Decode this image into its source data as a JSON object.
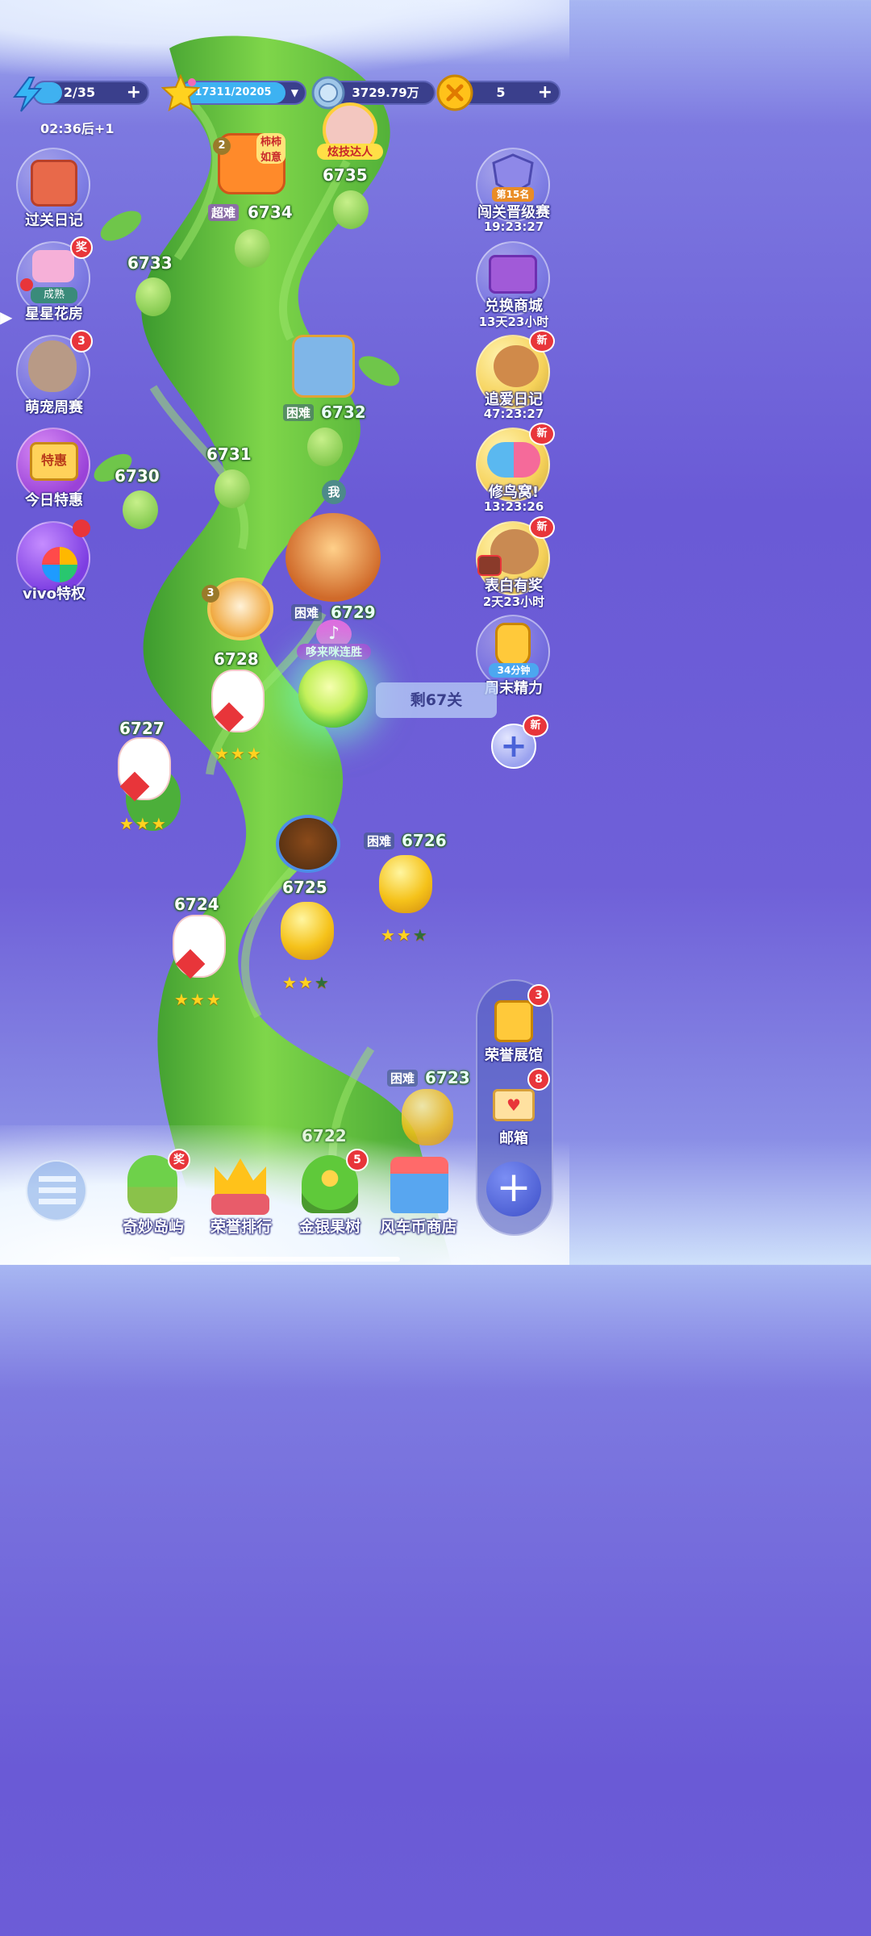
{
  "topbar": {
    "energy": {
      "value": "2/35",
      "plus": "+"
    },
    "stars": {
      "value": "17311/20205"
    },
    "coins": {
      "value": "3729.79万"
    },
    "tokens": {
      "value": "5",
      "plus": "+"
    },
    "timer": "02:36后+1"
  },
  "left_menu": [
    {
      "label": "过关日记"
    },
    {
      "label": "星星花房",
      "badge": "奖",
      "sub": "成熟"
    },
    {
      "label": "萌宠周赛",
      "badge": "3"
    },
    {
      "label": "今日特惠",
      "sub": "特惠"
    },
    {
      "label": "vivo特权"
    }
  ],
  "right_menu": [
    {
      "label": "闯关晋级赛",
      "timer": "19:23:27",
      "sub": "第15名"
    },
    {
      "label": "兑换商城",
      "timer": "13天23小时"
    },
    {
      "label": "追爱日记",
      "timer": "47:23:27",
      "badge": "新"
    },
    {
      "label": "修鸟窝!",
      "timer": "13:23:26",
      "badge": "新"
    },
    {
      "label": "表白有奖",
      "timer": "2天23小时",
      "badge": "新"
    },
    {
      "label": "周末精力",
      "sub": "34分钟"
    }
  ],
  "add_button_badge": "新",
  "levels": {
    "l6722": "6722",
    "l6723": "6723",
    "l6724": "6724",
    "l6725": "6725",
    "l6726": "6726",
    "l6727": "6727",
    "l6728": "6728",
    "l6729": "6729",
    "l6730": "6730",
    "l6731": "6731",
    "l6732": "6732",
    "l6733": "6733",
    "l6734": "6734",
    "l6735": "6735"
  },
  "tags": {
    "hard": "困难",
    "super_hard": "超难"
  },
  "banners": {
    "friend_top": "炫技达人",
    "sign_top": "柿柿如意",
    "me": "我",
    "streak": "哆来咪连胜",
    "remaining": "剩67关",
    "sign_num": "2",
    "sign_num2": "3"
  },
  "bottom_nav": [
    {
      "label": "奇妙岛屿",
      "badge": "奖"
    },
    {
      "label": "荣誉排行"
    },
    {
      "label": "金银果树",
      "badge": "5"
    },
    {
      "label": "风车币商店"
    }
  ],
  "right_panel": [
    {
      "label": "荣誉展馆",
      "badge": "3"
    },
    {
      "label": "邮箱",
      "badge": "8"
    }
  ],
  "stars_rows": {
    "s6728": 3,
    "s6727": 3,
    "s6724": 3,
    "s6725": 2,
    "s6726": 2
  }
}
